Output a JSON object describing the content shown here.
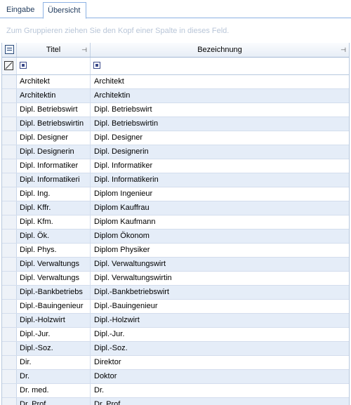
{
  "tabs": [
    {
      "label": "Eingabe",
      "active": false
    },
    {
      "label": "Übersicht",
      "active": true
    }
  ],
  "group_panel": {
    "hint": "Zum Gruppieren ziehen Sie den Kopf einer Spalte in dieses Feld."
  },
  "columns": {
    "titel": "Titel",
    "bezeichnung": "Bezeichnung"
  },
  "icons": {
    "column_chooser": "column-chooser-icon",
    "filter_clear": "filter-clear-icon",
    "pin": "pin-icon",
    "filter_operator": "filter-operator-icon"
  },
  "colors": {
    "alt_row": "#e5edf8",
    "tab_border": "#8db2e3",
    "tab_text": "#1e395b"
  },
  "rows": [
    {
      "titel": "Architekt",
      "bezeichnung": "Architekt"
    },
    {
      "titel": "Architektin",
      "bezeichnung": "Architektin"
    },
    {
      "titel": "Dipl. Betriebswirt",
      "bezeichnung": "Dipl. Betriebswirt"
    },
    {
      "titel": "Dipl. Betriebswirtin",
      "bezeichnung": "Dipl. Betriebswirtin"
    },
    {
      "titel": "Dipl. Designer",
      "bezeichnung": "Dipl. Designer"
    },
    {
      "titel": "Dipl. Designerin",
      "bezeichnung": "Dipl. Designerin"
    },
    {
      "titel": "Dipl. Informatiker",
      "bezeichnung": "Dipl. Informatiker"
    },
    {
      "titel": "Dipl. Informatikeri",
      "bezeichnung": "Dipl. Informatikerin"
    },
    {
      "titel": "Dipl. Ing.",
      "bezeichnung": "Diplom Ingenieur"
    },
    {
      "titel": "Dipl. Kffr.",
      "bezeichnung": "Diplom Kauffrau"
    },
    {
      "titel": "Dipl. Kfm.",
      "bezeichnung": "Diplom Kaufmann"
    },
    {
      "titel": "Dipl. Ök.",
      "bezeichnung": "Diplom Ökonom"
    },
    {
      "titel": "Dipl. Phys.",
      "bezeichnung": "Diplom Physiker"
    },
    {
      "titel": "Dipl. Verwaltungs",
      "bezeichnung": "Dipl. Verwaltungswirt"
    },
    {
      "titel": "Dipl. Verwaltungs",
      "bezeichnung": "Dipl. Verwaltungswirtin"
    },
    {
      "titel": "Dipl.-Bankbetriebs",
      "bezeichnung": "Dipl.-Bankbetriebswirt"
    },
    {
      "titel": "Dipl.-Bauingenieur",
      "bezeichnung": "Dipl.-Bauingenieur"
    },
    {
      "titel": "Dipl.-Holzwirt",
      "bezeichnung": "Dipl.-Holzwirt"
    },
    {
      "titel": "Dipl.-Jur.",
      "bezeichnung": "Dipl.-Jur."
    },
    {
      "titel": "Dipl.-Soz.",
      "bezeichnung": "Dipl.-Soz."
    },
    {
      "titel": "Dir.",
      "bezeichnung": "Direktor"
    },
    {
      "titel": "Dr.",
      "bezeichnung": "Doktor"
    },
    {
      "titel": "Dr. med.",
      "bezeichnung": "Dr."
    },
    {
      "titel": "Dr. Prof.",
      "bezeichnung": "Dr. Prof."
    }
  ]
}
